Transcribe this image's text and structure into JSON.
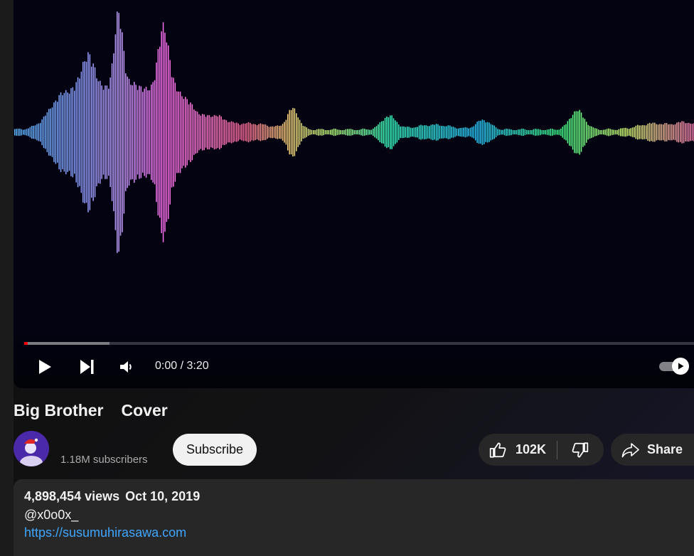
{
  "video": {
    "title_parts": [
      "Big Brother",
      "Cover"
    ],
    "time_display": "0:00 / 3:20",
    "progress_played_fraction": 0.0,
    "progress_buffered_fraction": 0.127,
    "autoplay": true
  },
  "channel": {
    "subscribers": "1.18M subscribers",
    "subscribe_label": "Subscribe"
  },
  "actions": {
    "like_count": "102K",
    "share_label": "Share"
  },
  "description": {
    "views": "4,898,454 views",
    "date": "Oct 10, 2019",
    "handle": "@x0o0x_",
    "link": "https://susumuhirasawa.com"
  },
  "icons": {
    "play": "play-icon",
    "next": "next-icon",
    "volume": "volume-icon",
    "autoplay": "autoplay-toggle-icon",
    "like": "thumbs-up-icon",
    "dislike": "thumbs-down-icon",
    "share": "share-icon"
  },
  "colors": {
    "player_bg": "#030312",
    "progress_played": "#ff0000",
    "link": "#3ea6ff"
  }
}
